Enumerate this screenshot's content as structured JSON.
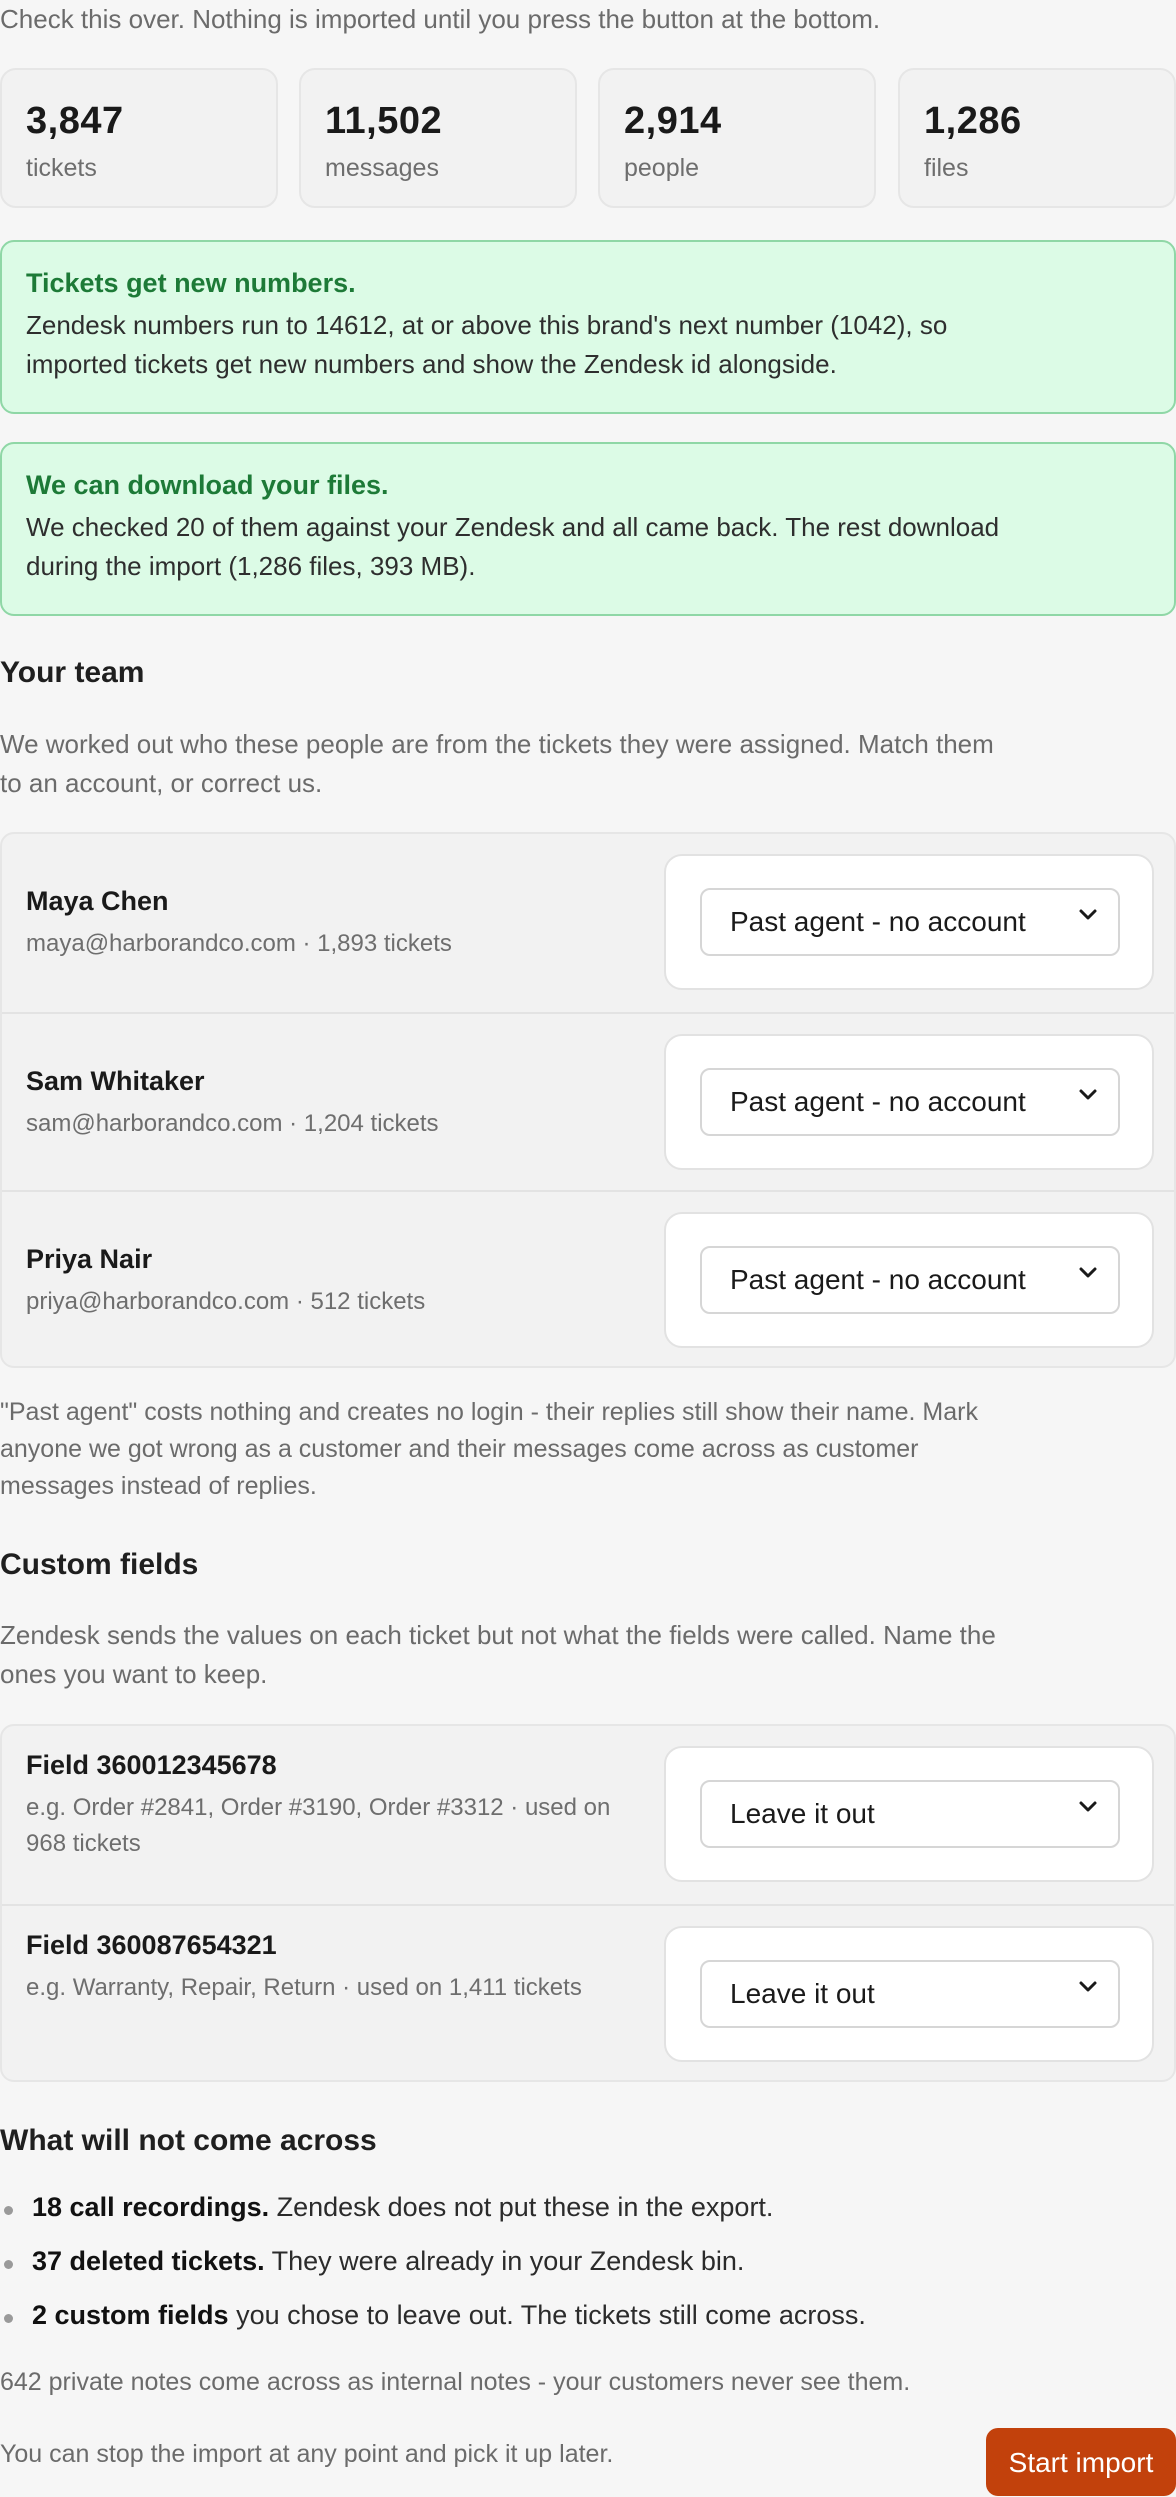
{
  "intro": "Check this over. Nothing is imported until you press the button at the bottom.",
  "stats": [
    {
      "value": "3,847",
      "label": "tickets"
    },
    {
      "value": "11,502",
      "label": "messages"
    },
    {
      "value": "2,914",
      "label": "people"
    },
    {
      "value": "1,286",
      "label": "files"
    }
  ],
  "notices": [
    {
      "title": "Tickets get new numbers.",
      "text": "Zendesk numbers run to 14612, at or above this brand's next number (1042), so imported tickets get new numbers and show the Zendesk id alongside."
    },
    {
      "title": "We can download your files.",
      "text": "We checked 20 of them against your Zendesk and all came back. The rest download during the import (1,286 files, 393 MB)."
    }
  ],
  "team": {
    "heading": "Your team",
    "description": "We worked out who these people are from the tickets they were assigned. Match them to an account, or correct us.",
    "members": [
      {
        "name": "Maya Chen",
        "meta": "maya@harborandco.com · 1,893 tickets",
        "selection": "Past agent - no account"
      },
      {
        "name": "Sam Whitaker",
        "meta": "sam@harborandco.com · 1,204 tickets",
        "selection": "Past agent - no account"
      },
      {
        "name": "Priya Nair",
        "meta": "priya@harborandco.com · 512 tickets",
        "selection": "Past agent - no account"
      }
    ],
    "note": "\"Past agent\" costs nothing and creates no login - their replies still show their name. Mark anyone we got wrong as a customer and their messages come across as customer messages instead of replies."
  },
  "fields": {
    "heading": "Custom fields",
    "description": "Zendesk sends the values on each ticket but not what the fields were called. Name the ones you want to keep.",
    "items": [
      {
        "name": "Field 360012345678",
        "meta": "e.g. Order #2841, Order #3190, Order #3312 · used on 968 tickets",
        "selection": "Leave it out"
      },
      {
        "name": "Field 360087654321",
        "meta": "e.g. Warranty, Repair, Return · used on 1,411 tickets",
        "selection": "Leave it out"
      }
    ]
  },
  "excluded": {
    "heading": "What will not come across",
    "items": [
      {
        "bold": "18 call recordings.",
        "rest": " Zendesk does not put these in the export."
      },
      {
        "bold": "37 deleted tickets.",
        "rest": " They were already in your Zendesk bin."
      },
      {
        "bold": "2 custom fields",
        "rest": " you chose to leave out. The tickets still come across."
      }
    ],
    "note": "642 private notes come across as internal notes - your customers never see them."
  },
  "footer": {
    "note": "You can stop the import at any point and pick it up later.",
    "button": "Start import"
  },
  "colors": {
    "accent": "#c2410c",
    "success_bg": "#dcfbe6",
    "success_text": "#1d7a37"
  }
}
